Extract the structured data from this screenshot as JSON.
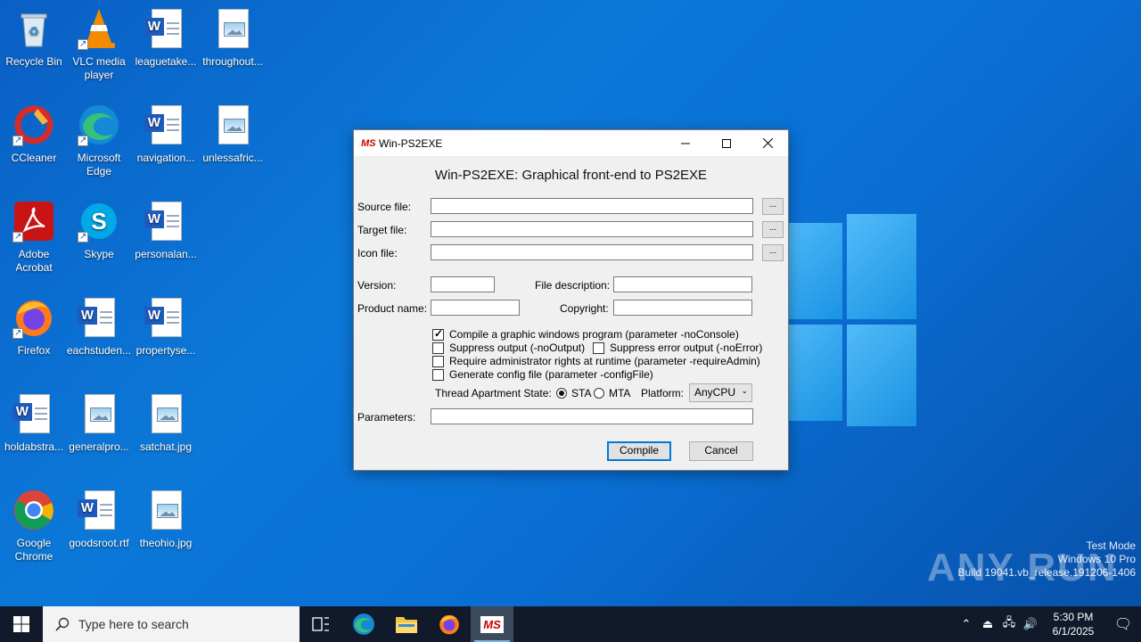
{
  "desktop": {
    "icons": [
      {
        "label": "Recycle Bin"
      },
      {
        "label": "VLC media player"
      },
      {
        "label": "leaguetake..."
      },
      {
        "label": "throughout..."
      },
      {
        "label": "CCleaner"
      },
      {
        "label": "Microsoft Edge"
      },
      {
        "label": "navigation..."
      },
      {
        "label": "unlessafric..."
      },
      {
        "label": "Adobe Acrobat"
      },
      {
        "label": "Skype"
      },
      {
        "label": "personalan..."
      },
      {
        "label": "Firefox"
      },
      {
        "label": "eachstuden..."
      },
      {
        "label": "propertyse..."
      },
      {
        "label": "holdabstra..."
      },
      {
        "label": "generalpro..."
      },
      {
        "label": "satchat.jpg"
      },
      {
        "label": "Google Chrome"
      },
      {
        "label": "goodsroot.rtf"
      },
      {
        "label": "theohio.jpg"
      }
    ]
  },
  "window": {
    "title": "Win-PS2EXE",
    "icon_text": "MS",
    "heading": "Win-PS2EXE: Graphical front-end to PS2EXE",
    "fields": {
      "source_label": "Source file:",
      "target_label": "Target file:",
      "icon_label": "Icon file:",
      "version_label": "Version:",
      "file_description_label": "File description:",
      "product_name_label": "Product name:",
      "copyright_label": "Copyright:",
      "parameters_label": "Parameters:",
      "source_value": "",
      "target_value": "",
      "icon_value": "",
      "version_value": "",
      "file_description_value": "",
      "product_name_value": "",
      "copyright_value": "",
      "parameters_value": ""
    },
    "browse_label": "...",
    "options": {
      "noconsole": {
        "label": "Compile a graphic windows program (parameter -noConsole)",
        "checked": true
      },
      "nooutput": {
        "label": "Suppress output (-noOutput)",
        "checked": false
      },
      "noerror": {
        "label": "Suppress error output (-noError)",
        "checked": false
      },
      "requireadmin": {
        "label": "Require administrator rights at runtime (parameter -requireAdmin)",
        "checked": false
      },
      "configfile": {
        "label": "Generate config file (parameter -configFile)",
        "checked": false
      }
    },
    "thread_apartment_label": "Thread Apartment State:",
    "sta_label": "STA",
    "mta_label": "MTA",
    "apartment_selected": "STA",
    "platform_label": "Platform:",
    "platform_value": "AnyCPU",
    "compile_label": "Compile",
    "cancel_label": "Cancel"
  },
  "watermark": {
    "logo": "ANY RUN",
    "line1": "Test Mode",
    "line2": "Windows 10 Pro",
    "line3": "Build 19041.vb_release.191206-1406"
  },
  "taskbar": {
    "search_placeholder": "Type here to search",
    "time": "5:30 PM",
    "date": "6/1/2025",
    "active_app_text": "MS"
  },
  "colors": {
    "accent": "#0078d7",
    "taskbar": "#101a2a",
    "desktop": "#0a6fd4"
  }
}
